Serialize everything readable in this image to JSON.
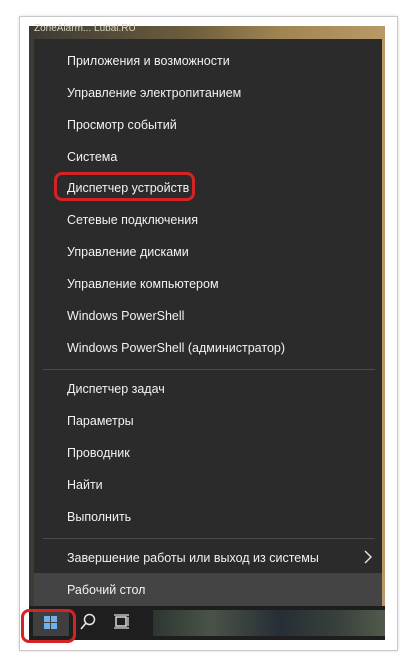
{
  "wallpaper_text": "ZoneAlarm... Lubal.RU",
  "menu": {
    "group1": [
      "Приложения и возможности",
      "Управление электропитанием",
      "Просмотр событий",
      "Система",
      "Диспетчер устройств",
      "Сетевые подключения",
      "Управление дисками",
      "Управление компьютером",
      "Windows PowerShell",
      "Windows PowerShell (администратор)"
    ],
    "group2": [
      "Диспетчер задач",
      "Параметры",
      "Проводник",
      "Найти",
      "Выполнить"
    ],
    "shutdown": "Завершение работы или выход из системы",
    "desktop": "Рабочий стол"
  },
  "colors": {
    "menu_bg": "#2b2b2b",
    "menu_text": "#f2f2f2",
    "highlight": "#d32323",
    "hover_bg": "#444444"
  },
  "icons": {
    "start": "windows-logo-icon",
    "search": "search-icon",
    "task_view": "task-view-icon",
    "submenu": "chevron-right-icon"
  }
}
